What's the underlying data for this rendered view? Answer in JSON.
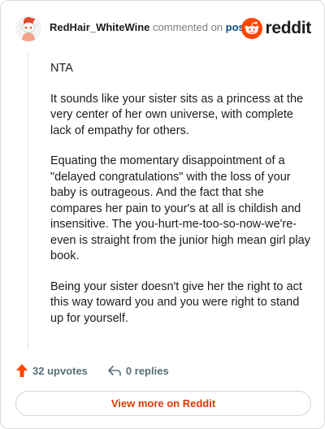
{
  "header": {
    "author": "RedHair_WhiteWine",
    "commented_text": "commented on",
    "post_link": "post",
    "brand_name": "reddit"
  },
  "comment": {
    "paragraphs": [
      "NTA",
      "It sounds like your sister sits as a princess at the very center of her own universe, with complete lack of empathy for others.",
      "Equating the momentary disappointment of a \"delayed congratulations\" with the loss of your baby is outrageous. And the fact that she compares her pain to your's at all is childish and insensitive. The you-hurt-me-too-so-now-we're-even is straight from the junior high mean girl play book.",
      "Being your sister doesn't give her the right to act this way toward you and you were right to stand up for yourself."
    ]
  },
  "footer": {
    "upvotes": "32 upvotes",
    "replies": "0 replies",
    "view_more": "View more on Reddit"
  },
  "icons": {
    "upvote": "upvote-arrow-icon",
    "reply": "reply-arrow-icon",
    "brand": "reddit-snoo-icon",
    "avatar": "snoo-avatar-icon"
  },
  "colors": {
    "reddit_orange": "#ff4500",
    "link_blue": "#0f4c8c",
    "view_more_text": "#d93a00",
    "meta_gray": "#576f76"
  }
}
